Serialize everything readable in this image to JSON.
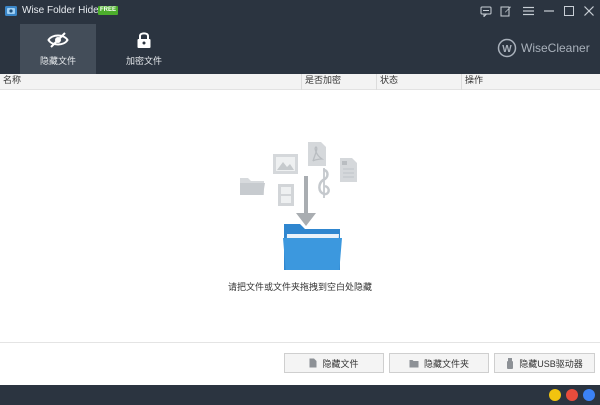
{
  "window": {
    "title": "Wise Folder Hider",
    "badge": "FREE"
  },
  "tabs": [
    {
      "label": "隐藏文件",
      "icon": "eye-slash-icon",
      "active": true
    },
    {
      "label": "加密文件",
      "icon": "padlock-icon",
      "active": false
    }
  ],
  "brand": {
    "name": "WiseCleaner",
    "logo_letter": "W"
  },
  "table": {
    "columns": [
      "名称",
      "是否加密",
      "状态",
      "操作"
    ]
  },
  "empty_state": {
    "hint": "请把文件或文件夹拖拽到空白处隐藏"
  },
  "actions": {
    "hide_file": "隐藏文件",
    "hide_folder": "隐藏文件夹",
    "hide_usb": "隐藏USB驱动器"
  },
  "colors": {
    "header_bg": "#2b3440",
    "active_tab_bg": "#434d59",
    "free_badge": "#4cae2c",
    "folder_blue": "#3c98de"
  }
}
